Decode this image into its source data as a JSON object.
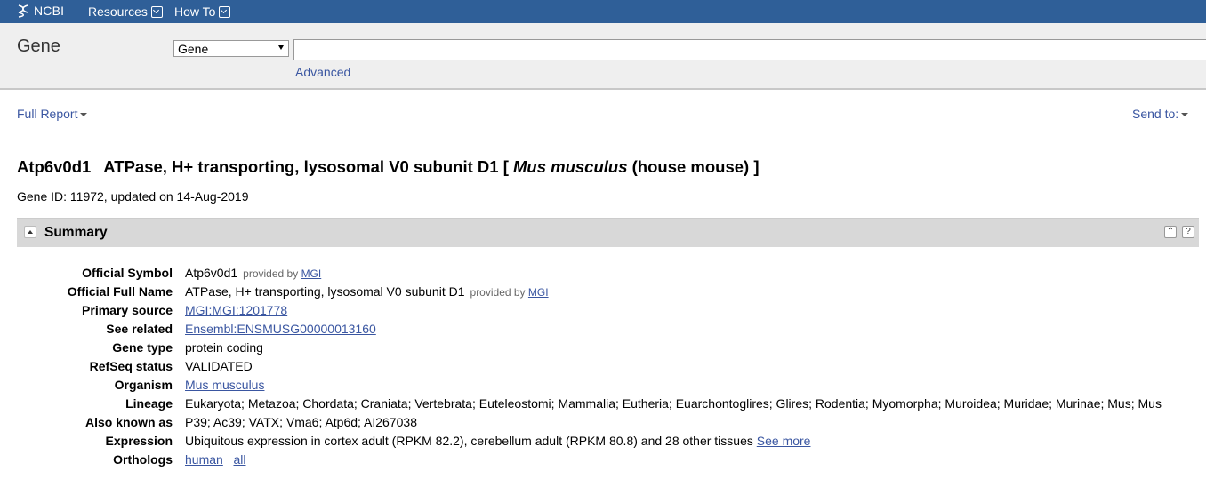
{
  "topbar": {
    "logo_text": "NCBI",
    "menu": [
      "Resources",
      "How To"
    ]
  },
  "search": {
    "db_title": "Gene",
    "db_selected": "Gene",
    "query": "",
    "advanced_label": "Advanced"
  },
  "report": {
    "format_label": "Full Report",
    "send_to_label": "Send to:"
  },
  "gene": {
    "symbol": "Atp6v0d1",
    "name_prefix": "ATPase, H+ transporting, lysosomal V0 subunit D1 [",
    "organism_italic": "Mus musculus",
    "organism_suffix": "(house mouse) ]",
    "id_line": "Gene ID: 11972, updated on 14-Aug-2019"
  },
  "summary": {
    "title": "Summary",
    "buttons": [
      "collapse-all",
      "help"
    ],
    "rows": {
      "official_symbol": {
        "label": "Official Symbol",
        "value": "Atp6v0d1",
        "provided": "provided by",
        "provider": "MGI"
      },
      "official_full_name": {
        "label": "Official Full Name",
        "value": "ATPase, H+ transporting, lysosomal V0 subunit D1",
        "provided": "provided by",
        "provider": "MGI"
      },
      "primary_source": {
        "label": "Primary source",
        "value": "MGI:MGI:1201778"
      },
      "see_related": {
        "label": "See related",
        "value": "Ensembl:ENSMUSG00000013160"
      },
      "gene_type": {
        "label": "Gene type",
        "value": "protein coding"
      },
      "refseq_status": {
        "label": "RefSeq status",
        "value": "VALIDATED"
      },
      "organism": {
        "label": "Organism",
        "value": "Mus musculus"
      },
      "lineage": {
        "label": "Lineage",
        "value": "Eukaryota; Metazoa; Chordata; Craniata; Vertebrata; Euteleostomi; Mammalia; Eutheria; Euarchontoglires; Glires; Rodentia; Myomorpha; Muroidea; Muridae; Murinae; Mus; Mus"
      },
      "also_known_as": {
        "label": "Also known as",
        "value": "P39; Ac39; VATX; Vma6; Atp6d; AI267038"
      },
      "expression": {
        "label": "Expression",
        "value": "Ubiquitous expression in cortex adult (RPKM 82.2), cerebellum adult (RPKM 80.8) and 28 other tissues",
        "link": "See more"
      },
      "orthologs": {
        "label": "Orthologs",
        "link1": "human",
        "link2": "all"
      }
    }
  }
}
